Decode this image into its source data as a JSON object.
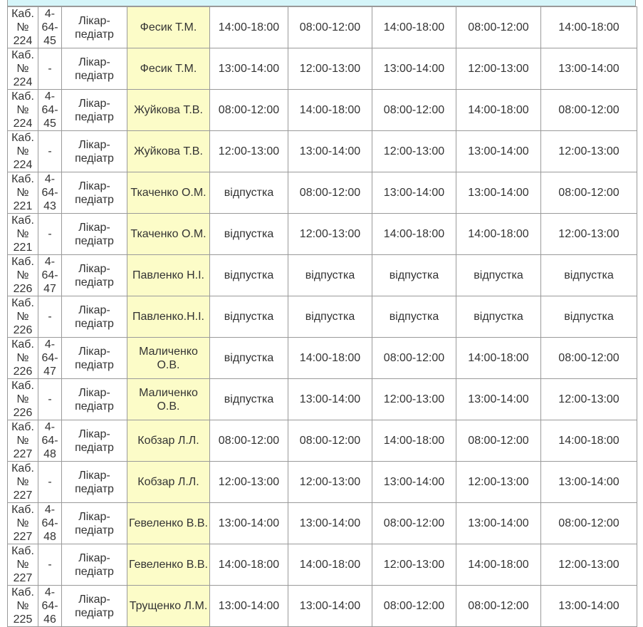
{
  "rows": [
    {
      "room": "Каб. № 224",
      "phone": "4-64-45",
      "position": "Лікар-педіатр",
      "doctor": "Фесик Т.М.",
      "times": [
        "14:00-18:00",
        "08:00-12:00",
        "14:00-18:00",
        "08:00-12:00",
        "14:00-18:00"
      ]
    },
    {
      "room": "Каб. № 224",
      "phone": "-",
      "position": "Лікар-педіатр",
      "doctor": "Фесик Т.М.",
      "times": [
        "13:00-14:00",
        "12:00-13:00",
        "13:00-14:00",
        "12:00-13:00",
        "13:00-14:00"
      ]
    },
    {
      "room": "Каб. № 224",
      "phone": "4-64-45",
      "position": "Лікар-педіатр",
      "doctor": "Жуйкова Т.В.",
      "times": [
        "08:00-12:00",
        "14:00-18:00",
        "08:00-12:00",
        "14:00-18:00",
        "08:00-12:00"
      ]
    },
    {
      "room": "Каб. № 224",
      "phone": "-",
      "position": "Лікар-педіатр",
      "doctor": "Жуйкова Т.В.",
      "times": [
        "12:00-13:00",
        "13:00-14:00",
        "12:00-13:00",
        "13:00-14:00",
        "12:00-13:00"
      ]
    },
    {
      "room": "Каб. № 221",
      "phone": "4-64-43",
      "position": "Лікар-педіатр",
      "doctor": "Ткаченко О.М.",
      "times": [
        "відпустка",
        "08:00-12:00",
        "13:00-14:00",
        "13:00-14:00",
        "08:00-12:00"
      ]
    },
    {
      "room": "Каб. № 221",
      "phone": "-",
      "position": "Лікар-педіатр",
      "doctor": "Ткаченко О.М.",
      "times": [
        "відпустка",
        "12:00-13:00",
        "14:00-18:00",
        "14:00-18:00",
        "12:00-13:00"
      ]
    },
    {
      "room": "Каб. № 226",
      "phone": "4-64-47",
      "position": "Лікар-педіатр",
      "doctor": "Павленко Н.І.",
      "times": [
        "відпустка",
        "відпустка",
        "відпустка",
        "відпустка",
        "відпустка"
      ]
    },
    {
      "room": "Каб. № 226",
      "phone": "-",
      "position": "Лікар-педіатр",
      "doctor": "Павленко.Н.І.",
      "times": [
        "відпустка",
        "відпустка",
        "відпустка",
        "відпустка",
        "відпустка"
      ]
    },
    {
      "room": "Каб. № 226",
      "phone": "4-64-47",
      "position": "Лікар-педіатр",
      "doctor": "Маличенко О.В.",
      "times": [
        "відпустка",
        "14:00-18:00",
        "08:00-12:00",
        "14:00-18:00",
        "08:00-12:00"
      ]
    },
    {
      "room": "Каб. № 226",
      "phone": "-",
      "position": "Лікар-педіатр",
      "doctor": "Маличенко О.В.",
      "times": [
        "відпустка",
        "13:00-14:00",
        "12:00-13:00",
        "13:00-14:00",
        "12:00-13:00"
      ]
    },
    {
      "room": "Каб. № 227",
      "phone": "4-64-48",
      "position": "Лікар-педіатр",
      "doctor": "Кобзар Л.Л.",
      "times": [
        "08:00-12:00",
        "08:00-12:00",
        "14:00-18:00",
        "08:00-12:00",
        "14:00-18:00"
      ]
    },
    {
      "room": "Каб. № 227",
      "phone": "-",
      "position": "Лікар-педіатр",
      "doctor": "Кобзар Л.Л.",
      "times": [
        "12:00-13:00",
        "12:00-13:00",
        "13:00-14:00",
        "12:00-13:00",
        "13:00-14:00"
      ]
    },
    {
      "room": "Каб. № 227",
      "phone": "4-64-48",
      "position": "Лікар-педіатр",
      "doctor": "Гевеленко В.В.",
      "times": [
        "13:00-14:00",
        "13:00-14:00",
        "08:00-12:00",
        "13:00-14:00",
        "08:00-12:00"
      ]
    },
    {
      "room": "Каб. № 227",
      "phone": "-",
      "position": "Лікар-педіатр",
      "doctor": "Гевеленко В.В.",
      "times": [
        "14:00-18:00",
        "14:00-18:00",
        "12:00-13:00",
        "14:00-18:00",
        "12:00-13:00"
      ]
    },
    {
      "room": "Каб. № 225",
      "phone": "4-64-46",
      "position": "Лікар-педіатр",
      "doctor": "Трущенко Л.М.",
      "times": [
        "13:00-14:00",
        "13:00-14:00",
        "08:00-12:00",
        "08:00-12:00",
        "13:00-14:00"
      ]
    }
  ]
}
